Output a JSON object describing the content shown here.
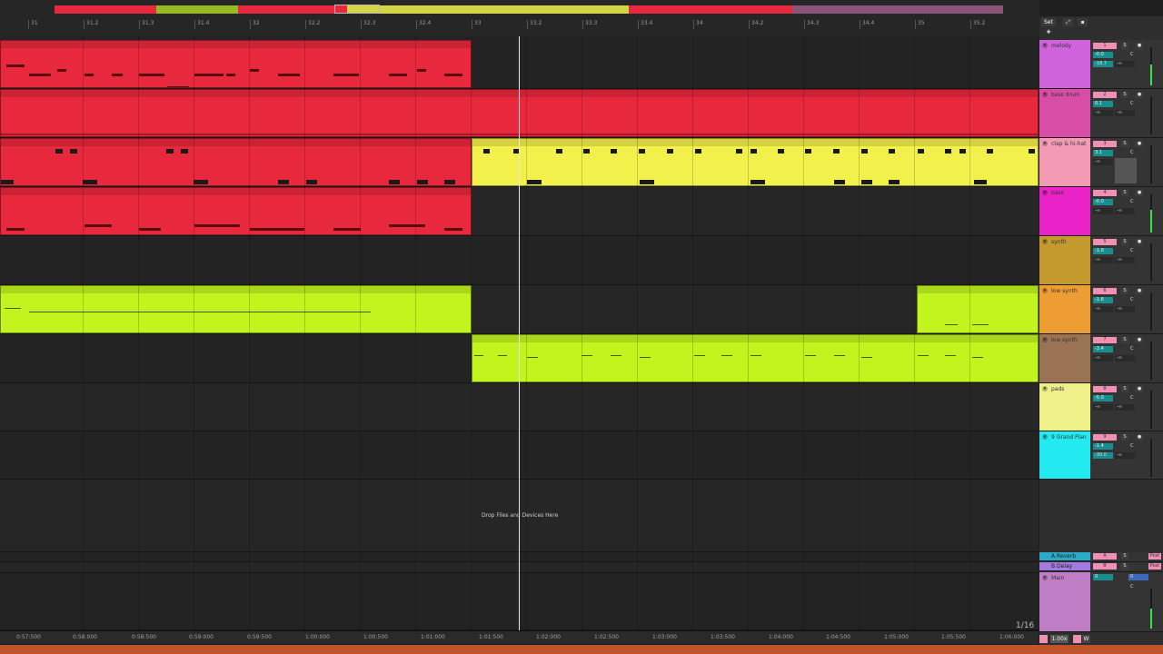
{
  "ruler": {
    "bars": [
      "31",
      "31.2",
      "31.3",
      "31.4",
      "32",
      "32.2",
      "32.3",
      "32.4",
      "33",
      "33.2",
      "33.3",
      "33.4",
      "34",
      "34.2",
      "34.3",
      "34.4",
      "35",
      "35.2"
    ]
  },
  "timeline": {
    "ticks": [
      "0:57:500",
      "0:58:000",
      "0:58:500",
      "0:59:000",
      "0:59:500",
      "1:00:000",
      "1:00:500",
      "1:01:000",
      "1:01:500",
      "1:02:000",
      "1:02:500",
      "1:03:000",
      "1:03:500",
      "1:04:000",
      "1:04:500",
      "1:05:000",
      "1:05:500",
      "1:06:000"
    ]
  },
  "drop_zone_text": "Drop Files and Devices Here",
  "page_indicator": "1/16",
  "header_controls": {
    "set_label": "Set",
    "zoom": "1.00x",
    "w_label": "W"
  },
  "colors": {
    "red_clip": "#e8283c",
    "yellow_clip": "#f2f04a",
    "lime_clip": "#c2f51e",
    "pink_accent": "#f08fb4",
    "teal_value": "#1a8e8e",
    "meter_green": "#3de04a"
  },
  "tracks": [
    {
      "name": "melody",
      "number": "1",
      "color": "#cf63dc",
      "vol": "-0.0",
      "pan": "C",
      "send_a": "-18.7",
      "send_b": "-∞",
      "meter": 0.55
    },
    {
      "name": "bass drum",
      "number": "2",
      "color": "#d84ea6",
      "vol": "0.1",
      "pan": "C",
      "send_a": "-∞",
      "send_b": "-∞",
      "meter": 0.0
    },
    {
      "name": "clap & hi-hat",
      "number": "3",
      "color": "#f39bb4",
      "vol": "3.1",
      "pan": "C",
      "send_a": "-∞",
      "send_b": "",
      "meter": 0.0
    },
    {
      "name": "bass",
      "number": "4",
      "color": "#ea23c8",
      "vol": "-0.0",
      "pan": "C",
      "send_a": "-∞",
      "send_b": "-∞",
      "meter": 0.6
    },
    {
      "name": "synth",
      "number": "5",
      "color": "#c49a2e",
      "vol": "-1.0",
      "pan": "C",
      "send_a": "-∞",
      "send_b": "-∞",
      "meter": 0.0
    },
    {
      "name": "low synth",
      "number": "6",
      "color": "#ee9c34",
      "vol": "-1.6",
      "pan": "C",
      "send_a": "-∞",
      "send_b": "-∞",
      "meter": 0.0
    },
    {
      "name": "low synth",
      "number": "7",
      "color": "#9a7353",
      "vol": "-3.4",
      "pan": "C",
      "send_a": "-∞",
      "send_b": "-∞",
      "meter": 0.0
    },
    {
      "name": "pads",
      "number": "8",
      "color": "#eef08a",
      "vol": "-5.0",
      "pan": "C",
      "send_a": "-∞",
      "send_b": "-∞",
      "meter": 0.0
    },
    {
      "name": "9 Grand Pian",
      "number": "9",
      "color": "#22eaf0",
      "vol": "-1.4",
      "pan": "C",
      "send_a": "-30.0",
      "send_b": "-∞",
      "meter": 0.0
    }
  ],
  "returns": [
    {
      "name": "A Reverb",
      "letter": "A",
      "color": "#2aaac6",
      "post": "Post"
    },
    {
      "name": "B Delay",
      "letter": "B",
      "color": "#a47ae0",
      "post": "Post"
    }
  ],
  "main": {
    "name": "Main",
    "color": "#c07ec6",
    "vol": "0",
    "send": "0",
    "pan": "C",
    "meter": 0.5
  }
}
